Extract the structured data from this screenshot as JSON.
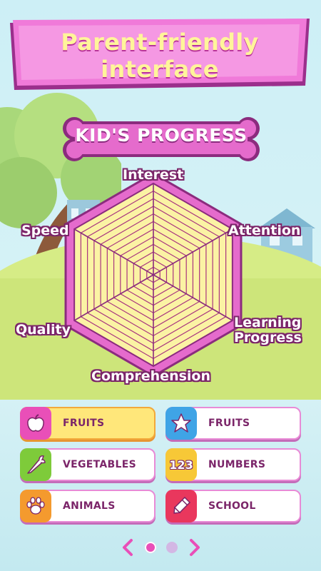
{
  "banner": {
    "line1": "Parent-friendly",
    "line2": "interface"
  },
  "card_title": "KID'S PROGRESS",
  "radar": {
    "axes": [
      "Interest",
      "Attention",
      "Learning Progress",
      "Comprehension",
      "Quality",
      "Speed"
    ],
    "learning_line1": "Learning",
    "learning_line2": "Progress"
  },
  "categories": [
    {
      "label": "FRUITS",
      "icon": "apple-icon",
      "color": "#e94fb8",
      "active": true
    },
    {
      "label": "FRUITS",
      "icon": "star-icon",
      "color": "#3fa4e6",
      "active": false
    },
    {
      "label": "VEGETABLES",
      "icon": "carrot-icon",
      "color": "#7ecb3a",
      "active": false
    },
    {
      "label": "NUMBERS",
      "icon": "numbers-icon",
      "color": "#f7c837",
      "active": false
    },
    {
      "label": "ANIMALS",
      "icon": "paw-icon",
      "color": "#f49a2e",
      "active": false
    },
    {
      "label": "SCHOOL",
      "icon": "crayon-icon",
      "color": "#e9375d",
      "active": false
    }
  ],
  "numbers_icon_text": "123",
  "pager": {
    "pages": 2,
    "current": 1
  },
  "colors": {
    "accent": "#e94fb8",
    "title": "#fff59a",
    "outline": "#7b2569"
  }
}
